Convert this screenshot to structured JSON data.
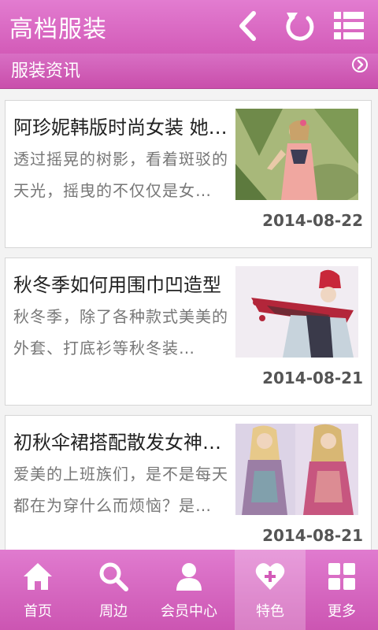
{
  "header": {
    "title": "高档服装",
    "icons": {
      "back": "back-arrow-icon",
      "refresh": "refresh-icon",
      "menu": "list-menu-icon"
    }
  },
  "section": {
    "title": "服装资讯",
    "more_icon": "chevron-right-circle-icon"
  },
  "articles": [
    {
      "title": "阿珍妮韩版时尚女装 她…",
      "summary": "透过摇晃的树影，看着斑驳的天光，摇曳的不仅仅是女…",
      "date": "2014-08-22"
    },
    {
      "title": "秋冬季如何用围巾凹造型",
      "summary": "秋冬季，除了各种款式美美的外套、打底衫等秋冬装…",
      "date": "2014-08-21"
    },
    {
      "title": "初秋伞裙搭配散发女神…",
      "summary": "爱美的上班族们，是不是每天都在为穿什么而烦恼？是…",
      "date": "2014-08-21"
    }
  ],
  "nav": {
    "items": [
      {
        "label": "首页",
        "icon": "home-icon"
      },
      {
        "label": "周边",
        "icon": "search-icon"
      },
      {
        "label": "会员中心",
        "icon": "user-icon"
      },
      {
        "label": "特色",
        "icon": "heart-plus-icon"
      },
      {
        "label": "更多",
        "icon": "grid-icon"
      }
    ],
    "active_index": 3
  },
  "colors": {
    "primary": "#d35bb8",
    "card_border": "#d6d6d6",
    "text": "#222222",
    "muted": "#777777"
  }
}
